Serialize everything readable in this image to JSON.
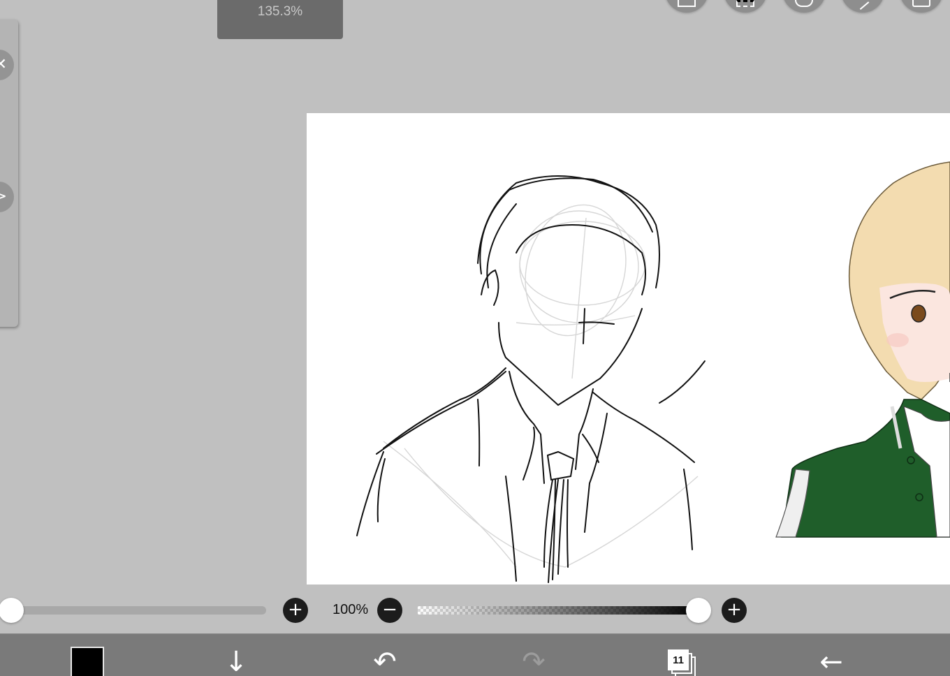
{
  "zoom": {
    "level": "135.3%"
  },
  "brush": {
    "size_fraction": 0.0
  },
  "opacity": {
    "label": "100%",
    "value_fraction": 1.0
  },
  "icons": {
    "size_plus": "+",
    "opacity_minus": "−",
    "opacity_plus": "+",
    "side_close": "close-icon",
    "side_expand": "chevron-right-icon",
    "download": "↓",
    "undo": "↶",
    "redo": "↷",
    "back": "←"
  },
  "toolbar": {
    "color_hex": "#000000",
    "layer_count": "11"
  },
  "colors": {
    "background": "#c0c0c0",
    "toolbar": "#7a7a7a",
    "canvas": "#ffffff",
    "jacket_green": "#1f5e2a",
    "hair_blonde": "#f3dcb0"
  }
}
